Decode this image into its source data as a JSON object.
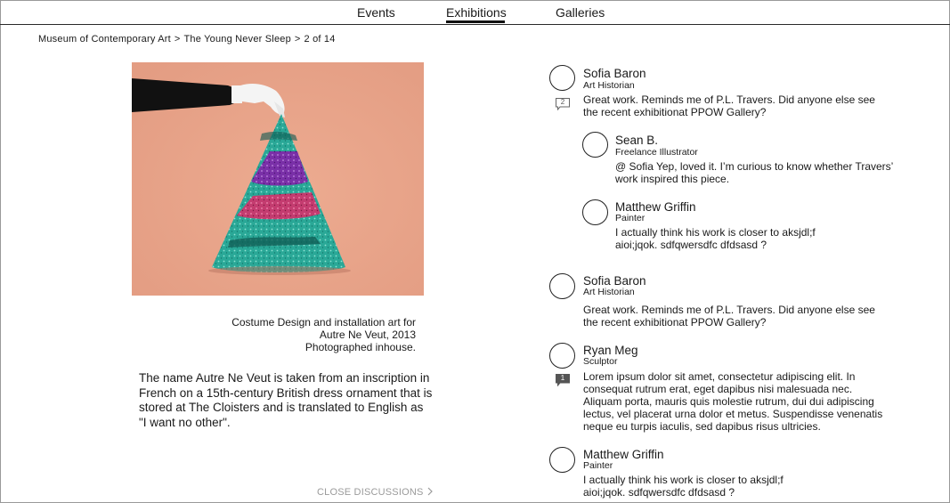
{
  "nav": {
    "tabs": [
      {
        "label": "Events"
      },
      {
        "label": "Exhibitions",
        "active": true
      },
      {
        "label": "Galleries"
      }
    ]
  },
  "breadcrumb": {
    "items": [
      "Museum of Contemporary Art",
      "The Young Never Sleep",
      "2 of 14"
    ],
    "separator": ">"
  },
  "artwork": {
    "caption": {
      "line1": "Costume Design and installation art for",
      "line2": "Autre Ne Veut, 2013",
      "line3": "Photographed inhouse."
    },
    "description": "The name Autre Ne Veut is taken from an inscription in French on a 15th-century British dress ornament that is stored at The Cloisters and is translated to English as \"I want no other\".",
    "colors": {
      "background": "#e9a488",
      "glitter_teal": "#27a596",
      "glitter_purple": "#7b2fa8",
      "glitter_pink": "#c43a6e"
    }
  },
  "close_discussions": {
    "label": "CLOSE DISCUSSIONS"
  },
  "comments": [
    {
      "name": "Sofia Baron",
      "role": "Art Historian",
      "text": "Great work. Reminds me of P.L. Travers. Did anyone else see the recent exhibitionat PPOW Gallery?",
      "reply_count": "2",
      "reply_icon": "speech-bubble-outline-icon"
    },
    {
      "name": "Sean B.",
      "role": "Freelance Illustrator",
      "text": "@ Sofia Yep, loved it. I’m curious to know whether Travers’ work inspired this piece."
    },
    {
      "name": "Matthew Griffin",
      "role": "Painter",
      "text": "I actually think his work is closer to aksjdl;f aioi;jqok. sdfqwersdfc dfdsasd ?"
    },
    {
      "name": "Sofia Baron",
      "role": "Art Historian",
      "text": "Great work. Reminds me of P.L. Travers. Did anyone else see the recent exhibitionat PPOW Gallery?"
    },
    {
      "name": "Ryan Meg",
      "role": "Sculptor",
      "text": "Lorem ipsum dolor sit amet, consectetur adipiscing elit. In consequat rutrum erat, eget dapibus nisi malesuada nec. Aliquam porta, mauris quis molestie rutrum, dui dui adipiscing lectus, vel placerat urna dolor et metus. Suspendisse venenatis neque eu turpis iaculis, sed dapibus risus ultricies.",
      "reply_count": "1",
      "reply_icon": "speech-bubble-filled-icon"
    },
    {
      "name": "Matthew Griffin",
      "role": "Painter",
      "text": "I actually think his work is closer to aksjdl;f aioi;jqok. sdfqwersdfc dfdsasd ?"
    }
  ]
}
